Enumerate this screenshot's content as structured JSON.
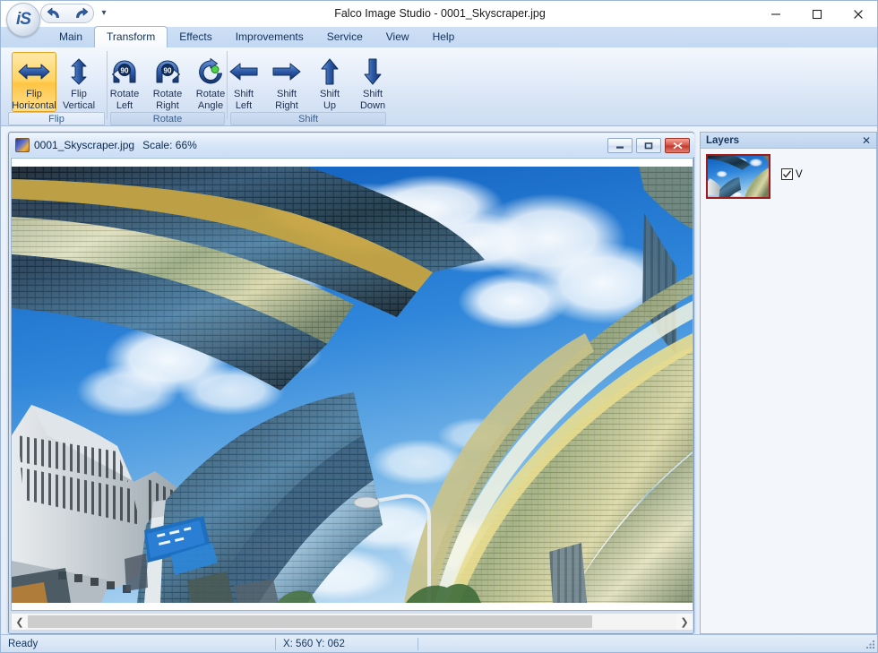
{
  "window": {
    "title": "Falco Image Studio - 0001_Skyscraper.jpg",
    "logo_text": "iS",
    "minimize_label": "Minimize",
    "maximize_label": "Maximize",
    "close_label": "Close"
  },
  "quick_access": {
    "undo_label": "Undo",
    "redo_label": "Redo",
    "more_label": "Customize Quick Access Toolbar",
    "more_glyph": "▾"
  },
  "ribbon": {
    "tabs": [
      {
        "label": "Main",
        "active": false
      },
      {
        "label": "Transform",
        "active": true
      },
      {
        "label": "Effects",
        "active": false
      },
      {
        "label": "Improvements",
        "active": false
      },
      {
        "label": "Service",
        "active": false
      },
      {
        "label": "View",
        "active": false
      },
      {
        "label": "Help",
        "active": false
      }
    ],
    "groups": [
      {
        "name": "Flip",
        "label": "Flip",
        "buttons": [
          {
            "id": "flip-horizontal",
            "line1": "Flip",
            "line2": "Horizontal",
            "icon": "flip-horizontal-icon",
            "selected": true
          },
          {
            "id": "flip-vertical",
            "line1": "Flip",
            "line2": "Vertical",
            "icon": "flip-vertical-icon",
            "selected": false
          }
        ]
      },
      {
        "name": "Rotate",
        "label": "Rotate",
        "buttons": [
          {
            "id": "rotate-left",
            "line1": "Rotate",
            "line2": "Left",
            "icon": "rotate-left-90-icon",
            "selected": false,
            "badge": "90"
          },
          {
            "id": "rotate-right",
            "line1": "Rotate",
            "line2": "Right",
            "icon": "rotate-right-90-icon",
            "selected": false,
            "badge": "90"
          },
          {
            "id": "rotate-angle",
            "line1": "Rotate",
            "line2": "Angle",
            "icon": "rotate-angle-icon",
            "selected": false
          }
        ]
      },
      {
        "name": "Shift",
        "label": "Shift",
        "buttons": [
          {
            "id": "shift-left",
            "line1": "Shift",
            "line2": "Left",
            "icon": "arrow-left-icon",
            "selected": false
          },
          {
            "id": "shift-right",
            "line1": "Shift",
            "line2": "Right",
            "icon": "arrow-right-icon",
            "selected": false
          },
          {
            "id": "shift-up",
            "line1": "Shift",
            "line2": "Up",
            "icon": "arrow-up-icon",
            "selected": false
          },
          {
            "id": "shift-down",
            "line1": "Shift",
            "line2": "Down",
            "icon": "arrow-down-icon",
            "selected": false
          }
        ]
      }
    ]
  },
  "document": {
    "filename": "0001_Skyscraper.jpg",
    "scale_text": "Scale: 66%",
    "minimize_glyph": "–",
    "restore_glyph": "□",
    "close_glyph": "✕",
    "scroll_left_glyph": "❮",
    "scroll_right_glyph": "❯"
  },
  "layers": {
    "title": "Layers",
    "close_glyph": "✕",
    "items": [
      {
        "label": "V",
        "checked": true,
        "selected": true
      }
    ]
  },
  "statusbar": {
    "message": "Ready",
    "coords": "X: 560 Y: 062",
    "extra": ""
  },
  "colors": {
    "accent": "#2f5fa8",
    "ribbon_tab_active": "#ffffff",
    "selection_orange": "#ffc544",
    "layer_select_border": "#9e1b1b",
    "close_red": "#c43a2c"
  }
}
